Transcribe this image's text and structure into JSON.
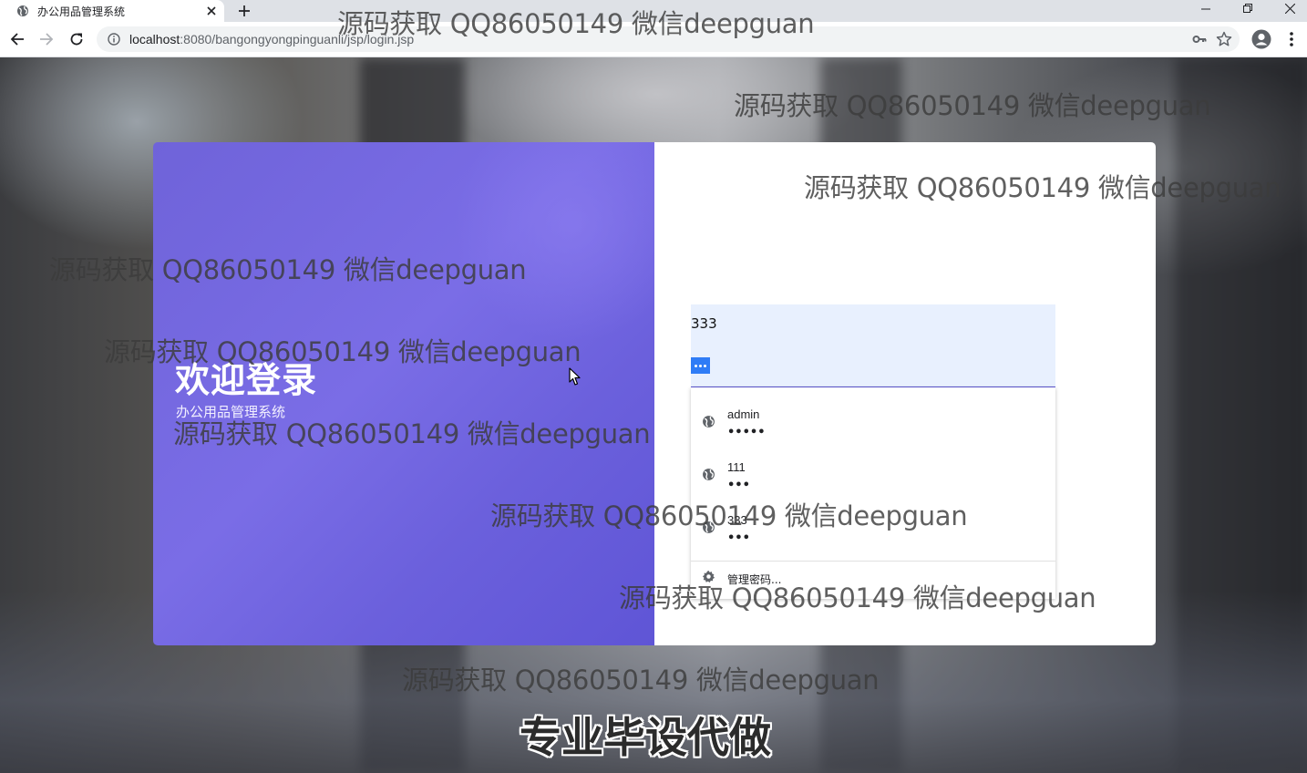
{
  "browser": {
    "tab_title": "办公用品管理系统",
    "url_host": "localhost",
    "url_rest": ":8080/bangongyongpinguanli/jsp/login.jsp"
  },
  "login": {
    "welcome_title": "欢迎登录",
    "welcome_subtitle": "办公用品管理系统",
    "username_value": "333",
    "password_mask": "•••"
  },
  "autofill": {
    "items": [
      {
        "username": "admin",
        "mask": "•••••"
      },
      {
        "username": "111",
        "mask": "•••"
      },
      {
        "username": "333",
        "mask": "•••"
      }
    ],
    "manage_label": "管理密码..."
  },
  "watermark_text": "源码获取 QQ86050149 微信deepguan",
  "caption_text": "专业毕设代做",
  "colors": {
    "panel_purple": "#7066dd",
    "autofill_bg": "#e8f0fe",
    "selection_blue": "#2f7cf6"
  }
}
